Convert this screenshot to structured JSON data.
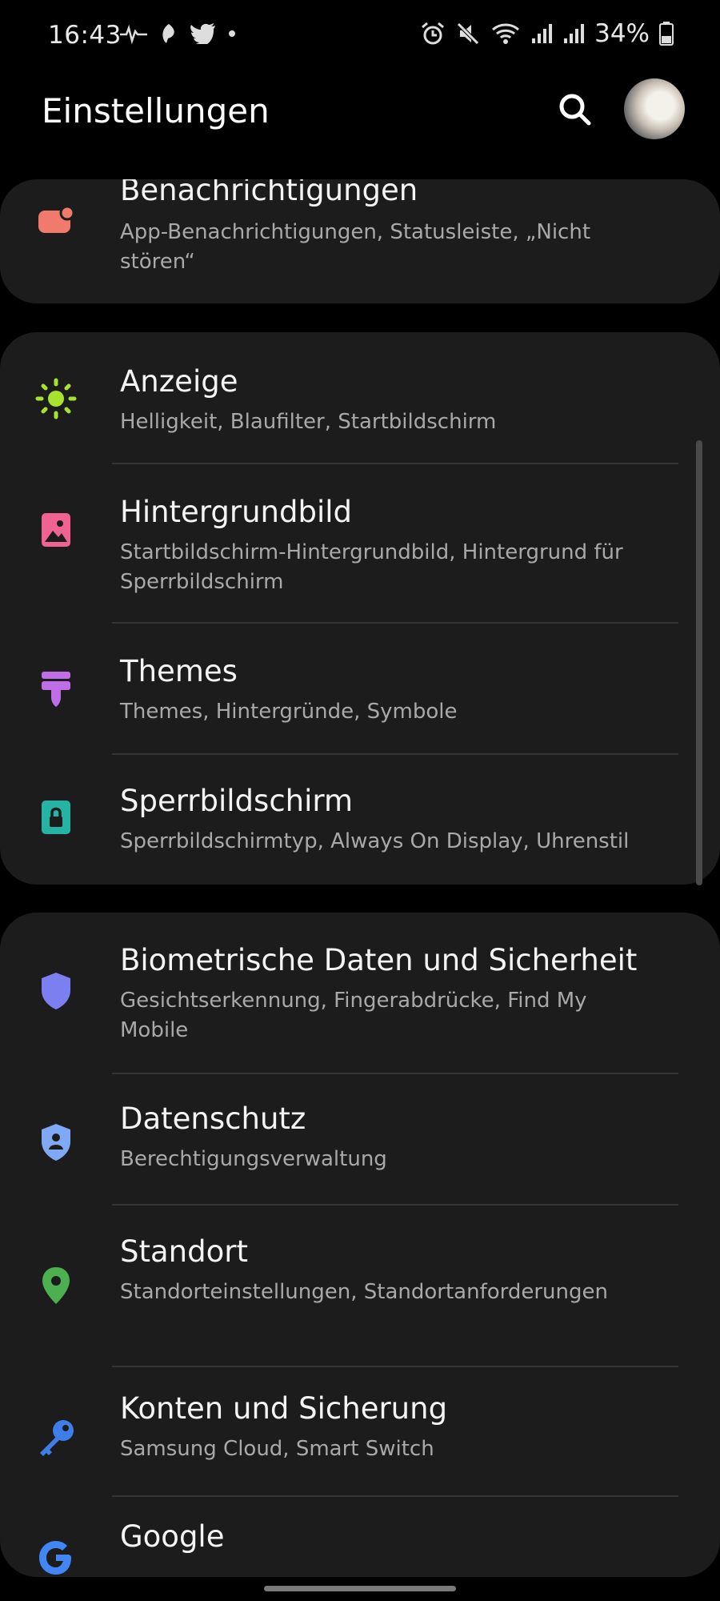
{
  "status_bar": {
    "time": "16:43",
    "battery": "34%",
    "left_icons": [
      "pulse-icon",
      "feather-icon",
      "twitter-icon",
      "dot-icon"
    ],
    "right_icons": [
      "alarm-icon",
      "mute-icon",
      "wifi-icon",
      "signal-icon",
      "signal-icon",
      "battery-icon"
    ]
  },
  "header": {
    "title": "Einstellungen"
  },
  "cards": [
    [
      {
        "title": "Benachrichtigungen",
        "subtitle": "App-Benachrichtigungen, Statusleiste, „Nicht stören“",
        "icon": "notification-icon",
        "color": "#f07a6b"
      }
    ],
    [
      {
        "title": "Anzeige",
        "subtitle": "Helligkeit, Blaufilter, Startbildschirm",
        "icon": "sun-icon",
        "color": "#a6e22e"
      },
      {
        "title": "Hintergrundbild",
        "subtitle": "Startbildschirm-Hintergrundbild, Hintergrund für Sperrbildschirm",
        "icon": "wallpaper-icon",
        "color": "#f06292"
      },
      {
        "title": "Themes",
        "subtitle": "Themes, Hintergründe, Symbole",
        "icon": "brush-icon",
        "color": "#c06ee8"
      },
      {
        "title": "Sperrbildschirm",
        "subtitle": "Sperrbildschirmtyp, Always On Display, Uhrenstil",
        "icon": "lock-icon",
        "color": "#26b3a4"
      }
    ],
    [
      {
        "title": "Biometrische Daten und Sicherheit",
        "subtitle": "Gesichtserkennung, Fingerabdrücke, Find My Mobile",
        "icon": "shield-icon",
        "color": "#7b7ff0"
      },
      {
        "title": "Datenschutz",
        "subtitle": "Berechtigungsverwaltung",
        "icon": "privacy-shield-icon",
        "color": "#7fa8f5"
      },
      {
        "title": "Standort",
        "subtitle": "Standorteinstellungen, Standortanforderungen",
        "icon": "location-pin-icon",
        "color": "#4caf50"
      },
      {
        "title": "Konten und Sicherung",
        "subtitle": "Samsung Cloud, Smart Switch",
        "icon": "key-icon",
        "color": "#3f7de8"
      },
      {
        "title": "Google",
        "subtitle": "",
        "icon": "google-icon",
        "color": "#4285f4"
      }
    ]
  ]
}
